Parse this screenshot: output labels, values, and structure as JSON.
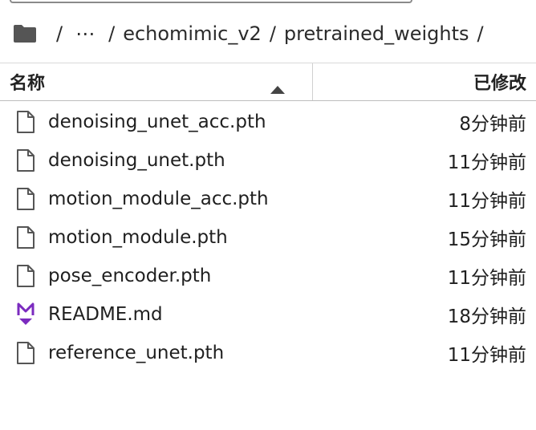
{
  "breadcrumb": {
    "ellipsis": "⋯",
    "parts": [
      "echomimic_v2",
      "pretrained_weights"
    ],
    "separator": "/"
  },
  "header": {
    "name_label": "名称",
    "modified_label": "已修改",
    "sort": "ascending"
  },
  "files": [
    {
      "name": "denoising_unet_acc.pth",
      "modified": "8分钟前",
      "icon": "file-icon"
    },
    {
      "name": "denoising_unet.pth",
      "modified": "11分钟前",
      "icon": "file-icon"
    },
    {
      "name": "motion_module_acc.pth",
      "modified": "11分钟前",
      "icon": "file-icon"
    },
    {
      "name": "motion_module.pth",
      "modified": "15分钟前",
      "icon": "file-icon"
    },
    {
      "name": "pose_encoder.pth",
      "modified": "11分钟前",
      "icon": "file-icon"
    },
    {
      "name": "README.md",
      "modified": "18分钟前",
      "icon": "markdown-icon"
    },
    {
      "name": "reference_unet.pth",
      "modified": "11分钟前",
      "icon": "file-icon"
    }
  ],
  "colors": {
    "markdown_icon": "#7b2bbf",
    "icon_stroke": "#555555"
  }
}
